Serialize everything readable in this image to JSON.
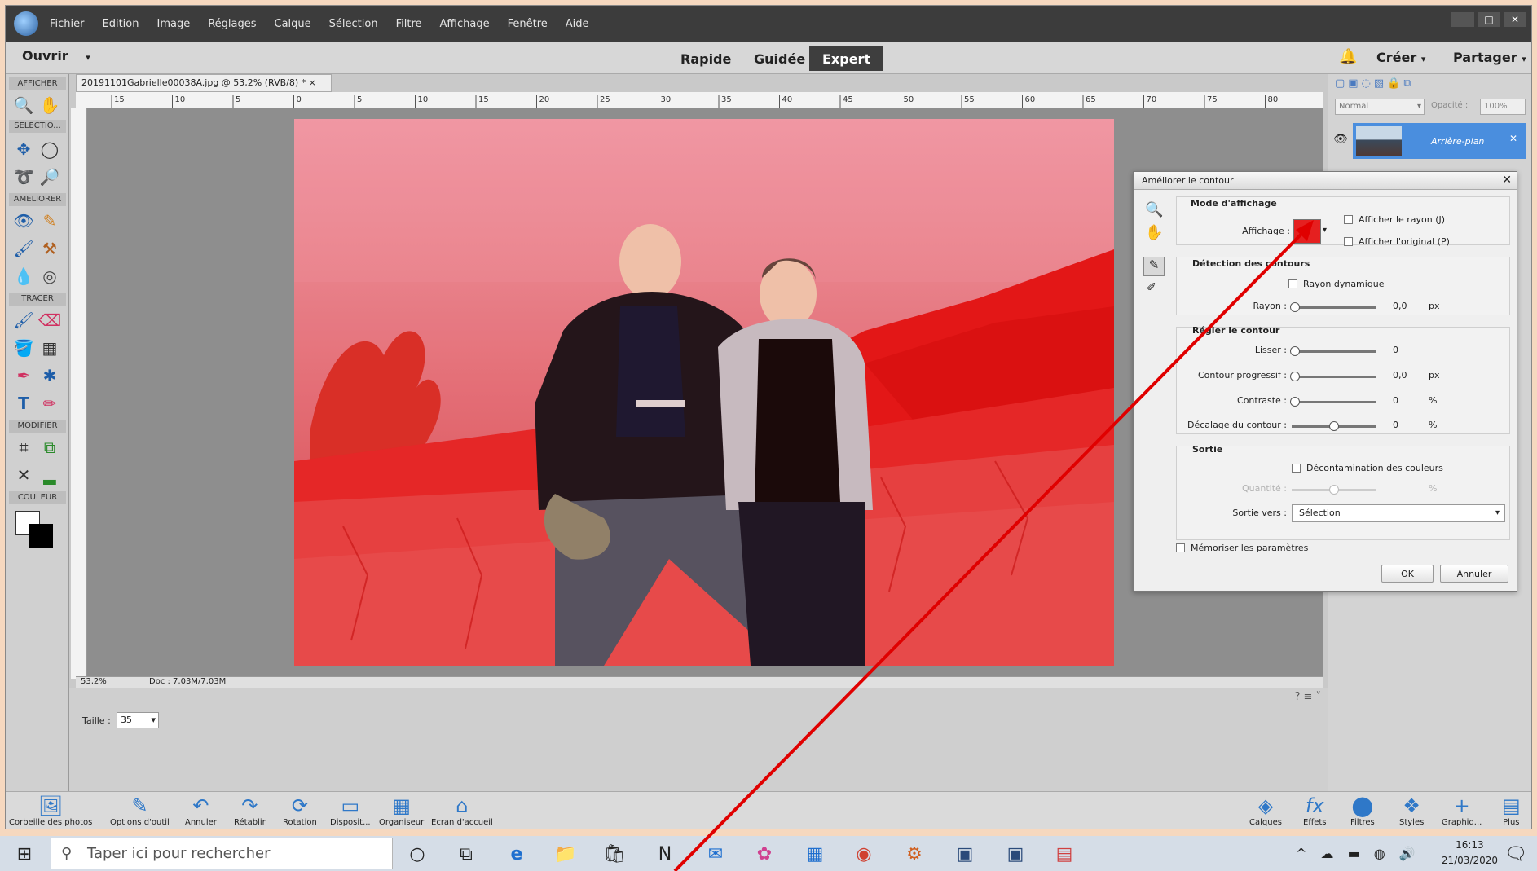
{
  "menubar": {
    "items": [
      "Fichier",
      "Edition",
      "Image",
      "Réglages",
      "Calque",
      "Sélection",
      "Filtre",
      "Affichage",
      "Fenêtre",
      "Aide"
    ],
    "window_controls": [
      "–",
      "□",
      "✕"
    ]
  },
  "modebar": {
    "open_label": "Ouvrir",
    "modes": [
      "Rapide",
      "Guidée",
      "Expert"
    ],
    "active_mode": "Expert",
    "create_label": "Créer",
    "share_label": "Partager"
  },
  "tools": {
    "sections": [
      "AFFICHER",
      "SELECTIO...",
      "AMELIORER",
      "TRACER",
      "MODIFIER",
      "COULEUR"
    ]
  },
  "document": {
    "tab_title": "20191101Gabrielle00038A.jpg @ 53,2% (RVB/8) * ×",
    "ruler_marks": [
      "15",
      "10",
      "5",
      "0",
      "5",
      "10",
      "15",
      "20",
      "25",
      "30",
      "35",
      "40",
      "45",
      "50",
      "55",
      "60",
      "65",
      "70",
      "75",
      "80"
    ],
    "zoom": "53,2%",
    "doc_info": "Doc : 7,03M/7,03M"
  },
  "tool_options": {
    "size_label": "Taille :",
    "size_value": "35"
  },
  "layers_panel": {
    "blend_mode": "Normal",
    "opacity_label": "Opacité :",
    "opacity_value": "100%",
    "layer_name": "Arrière-plan"
  },
  "dialog": {
    "title": "Améliorer le contour",
    "view_mode_heading": "Mode d'affichage",
    "affichage_label": "Affichage :",
    "show_radius": "Afficher le rayon (J)",
    "show_original": "Afficher l'original (P)",
    "edge_detection_heading": "Détection des contours",
    "smart_radius": "Rayon dynamique",
    "radius_label": "Rayon :",
    "radius_value": "0,0",
    "radius_unit": "px",
    "adjust_edge_heading": "Régler le contour",
    "smooth_label": "Lisser :",
    "smooth_value": "0",
    "feather_label": "Contour progressif :",
    "feather_value": "0,0",
    "feather_unit": "px",
    "contrast_label": "Contraste :",
    "contrast_value": "0",
    "contrast_unit": "%",
    "shift_label": "Décalage du contour :",
    "shift_value": "0",
    "shift_unit": "%",
    "output_heading": "Sortie",
    "decontaminate": "Décontamination des couleurs",
    "amount_label": "Quantité :",
    "amount_unit": "%",
    "output_to_label": "Sortie vers :",
    "output_to_value": "Sélection",
    "remember": "Mémoriser les paramètres",
    "ok": "OK",
    "cancel": "Annuler"
  },
  "dock": {
    "left_items": [
      "Corbeille des photos",
      "Options d'outil",
      "Annuler",
      "Rétablir",
      "Rotation",
      "Disposit...",
      "Organiseur",
      "Ecran d'accueil"
    ],
    "right_items": [
      "Calques",
      "Effets",
      "Filtres",
      "Styles",
      "Graphiq...",
      "Plus"
    ]
  },
  "taskbar": {
    "search_placeholder": "Taper ici pour rechercher",
    "time": "16:13",
    "date": "21/03/2020"
  },
  "colors": {
    "overlay_red": "#e01010",
    "mode_active_bg": "#3e3e3e",
    "layer_selected": "#4a8ede",
    "annotation_arrow": "#e00000"
  }
}
